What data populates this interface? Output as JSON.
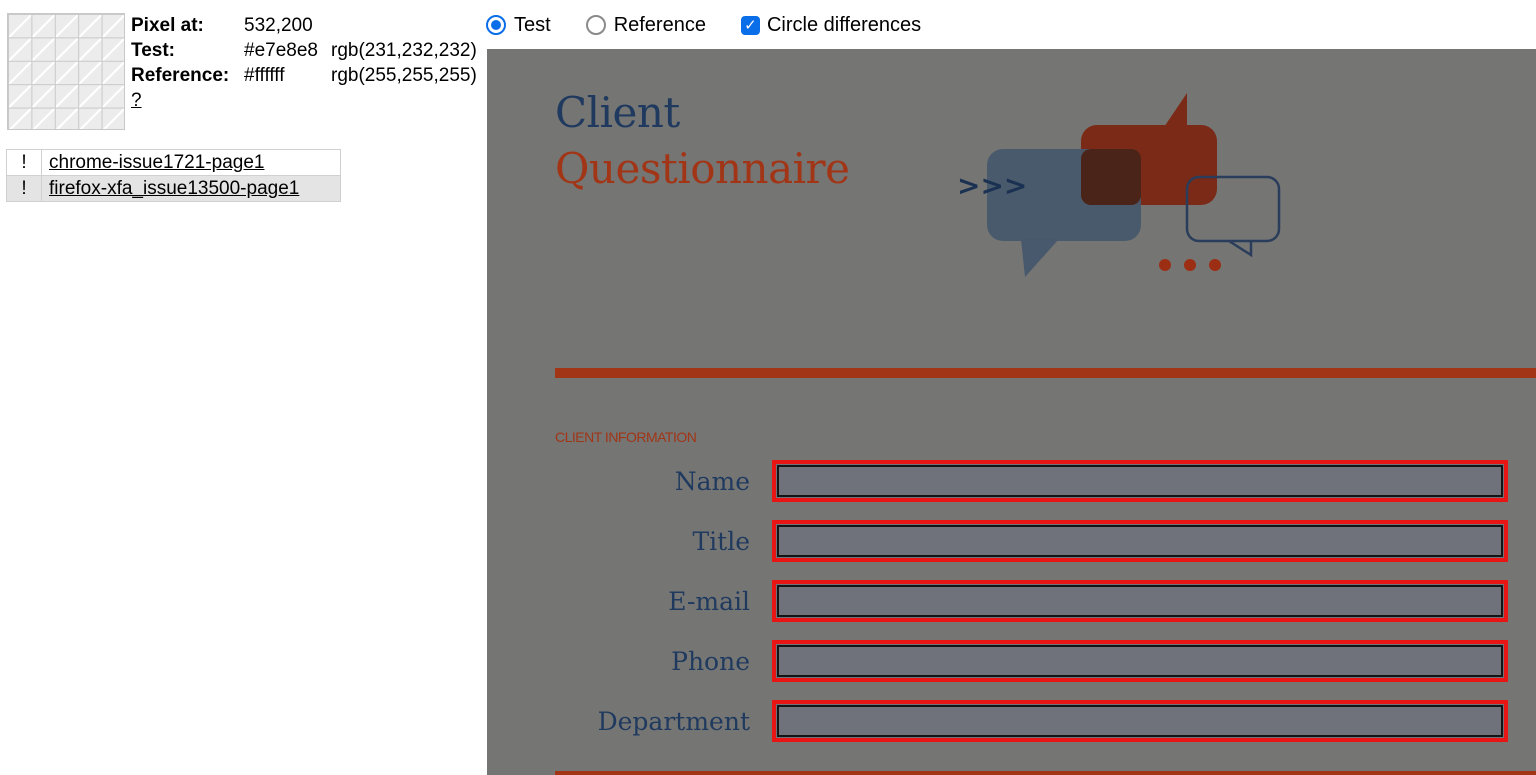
{
  "pixel_info": {
    "pixel_at_label": "Pixel at:",
    "pixel_at_value": "532,200",
    "test_label": "Test:",
    "test_hex": "#e7e8e8",
    "test_rgb": "rgb(231,232,232)",
    "reference_label": "Reference:",
    "reference_hex": "#ffffff",
    "reference_rgb": "rgb(255,255,255)",
    "help": "?"
  },
  "controls": {
    "test_label": "Test",
    "reference_label": "Reference",
    "circle_label": "Circle differences",
    "selected_view": "Test",
    "circle_checked": true
  },
  "files": [
    {
      "flag": "!",
      "name": "chrome-issue1721-page1",
      "selected": false
    },
    {
      "flag": "!",
      "name": "firefox-xfa_issue13500-page1",
      "selected": true
    }
  ],
  "document": {
    "title_line1": "Client",
    "title_line2": "Questionnaire",
    "art_text": ">>>",
    "section_heading": "CLIENT INFORMATION",
    "fields": [
      "Name",
      "Title",
      "E-mail",
      "Phone",
      "Department"
    ]
  },
  "colors": {
    "accent_blue": "#0a6ee8",
    "viewer_bg": "#757574",
    "doc_navy": "#1f3a5e",
    "doc_red": "#a13516",
    "diff_circle": "#e81515"
  },
  "icons": {
    "checkbox": "checkmark-icon",
    "art": "speech-bubbles-icon"
  }
}
